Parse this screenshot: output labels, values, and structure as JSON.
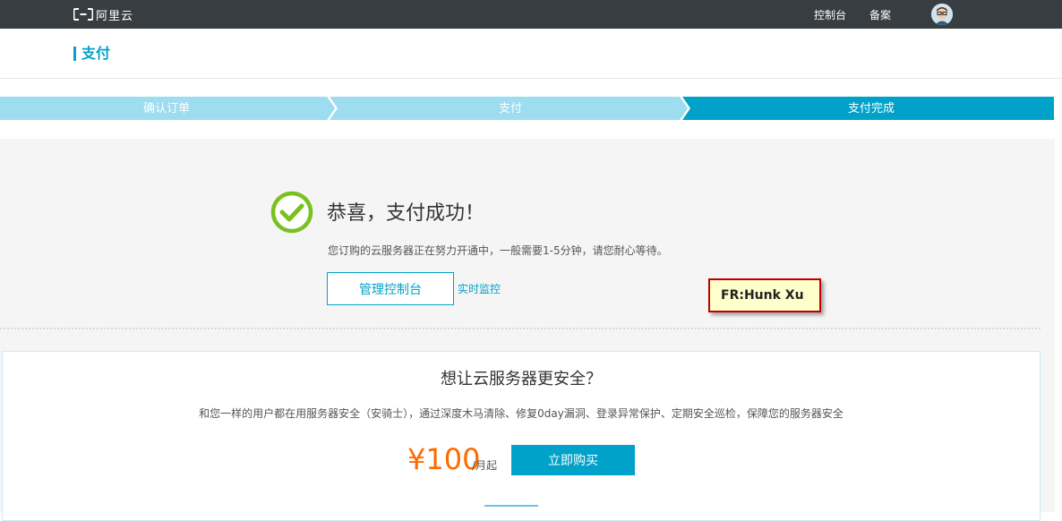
{
  "topbar": {
    "logo_text": "阿里云",
    "nav": {
      "console": "控制台",
      "beian": "备案"
    }
  },
  "page": {
    "title": "支付"
  },
  "steps": [
    "确认订单",
    "支付",
    "支付完成"
  ],
  "colors": {
    "accent": "#00a2ca",
    "step_inactive": "#9edcf0",
    "step_active": "#00a2ca",
    "success_green": "#7ac11f",
    "price_orange": "#ff6a00",
    "note_border": "#c00000",
    "note_bg": "#ffffcc"
  },
  "success": {
    "icon": "check-circle-icon",
    "title": "恭喜，支付成功！",
    "description": "您订购的云服务器正在努力开通中，一般需要1-5分钟，请您耐心等待。",
    "console_button": "管理控制台",
    "monitor_link": "实时监控"
  },
  "promo": {
    "title": "想让云服务器更安全？",
    "description": "和您一样的用户都在用服务器安全（安骑士），通过深度木马清除、修复0day漏洞、登录异常保护、定期安全巡检，保障您的服务器安全",
    "price": "¥100",
    "price_unit": "/月起",
    "buy_button": "立即购买"
  },
  "note": {
    "text": "FR:Hunk Xu"
  }
}
